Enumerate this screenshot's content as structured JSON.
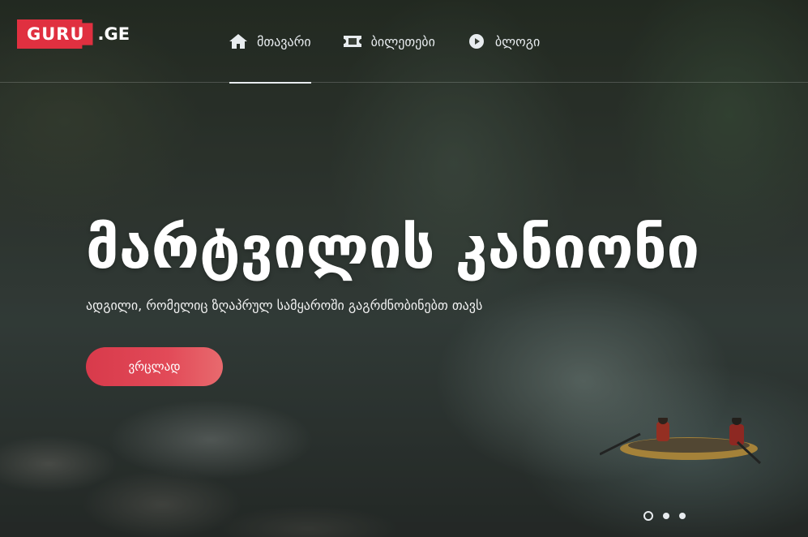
{
  "brand": {
    "logo_main": "GURU",
    "logo_suffix": ".GE",
    "accent": "#e03040"
  },
  "nav": {
    "items": [
      {
        "label": "მთავარი",
        "icon": "home-icon",
        "active": true
      },
      {
        "label": "ბილეთები",
        "icon": "ticket-icon",
        "active": false
      },
      {
        "label": "ბლოგი",
        "icon": "play-circle-icon",
        "active": false
      }
    ]
  },
  "hero": {
    "title": "მარტვილის კანიონი",
    "subtitle": "ადგილი, რომელიც ზღაპრულ სამყაროში გაგრძნობინებთ თავს",
    "cta_label": "ვრცლად",
    "cta_color": "#e24a58"
  },
  "slider": {
    "slide_count": 3,
    "active_index": 0
  }
}
